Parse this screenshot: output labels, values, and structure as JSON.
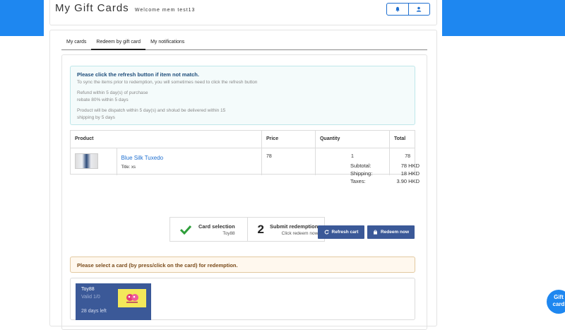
{
  "header": {
    "title": "My Gift Cards",
    "welcome": "Welcome mem test13",
    "bell_icon": "bell-icon",
    "user_icon": "user-icon"
  },
  "tabs": [
    {
      "label": "My cards",
      "active": false
    },
    {
      "label": "Redeem by gift card",
      "active": true
    },
    {
      "label": "My notifications",
      "active": false
    }
  ],
  "info": {
    "title": "Please click the refresh button if item not match.",
    "line1": "To sync the items prior to redemption, you will sometimes need to click the refresh button",
    "refund1": "Refund within 5 day(s) of purchase",
    "refund2": "rebate 80% within 5 days",
    "dispatch1": "Product will be dispatch within 5 day(s) and sholud be delivered within 15",
    "dispatch2": "shipping by 5 days"
  },
  "table": {
    "headers": [
      "Product",
      "Price",
      "Quantity",
      "Total"
    ],
    "rows": [
      {
        "name": "Blue Silk Tuxedo",
        "subtitle": "Title: xs",
        "price": "78",
        "quantity": "1",
        "total": "78"
      }
    ]
  },
  "totals": {
    "subtotal_label": "Subtotal:",
    "subtotal": "78 HKD",
    "shipping_label": "Shipping:",
    "shipping": "18 HKD",
    "taxes_label": "Taxes:",
    "taxes": "3.90 HKD"
  },
  "steps": {
    "step1_title": "Card selection",
    "step1_sub": "Toy88",
    "step2_num": "2",
    "step2_title": "Submit redemption",
    "step2_sub": "Click redeem now"
  },
  "buttons": {
    "refresh": "Refresh cart",
    "redeem": "Redeem now"
  },
  "warning": "Please select a card (by press/click on the card) for redemption.",
  "card": {
    "name": "Toy88",
    "value": "Valid 1/0",
    "days": "28 days left"
  },
  "fab": {
    "line1": "Gift",
    "line2": "card"
  },
  "colors": {
    "primary": "#1e87f0",
    "button": "#3b5998",
    "check": "#2e9e3a"
  }
}
